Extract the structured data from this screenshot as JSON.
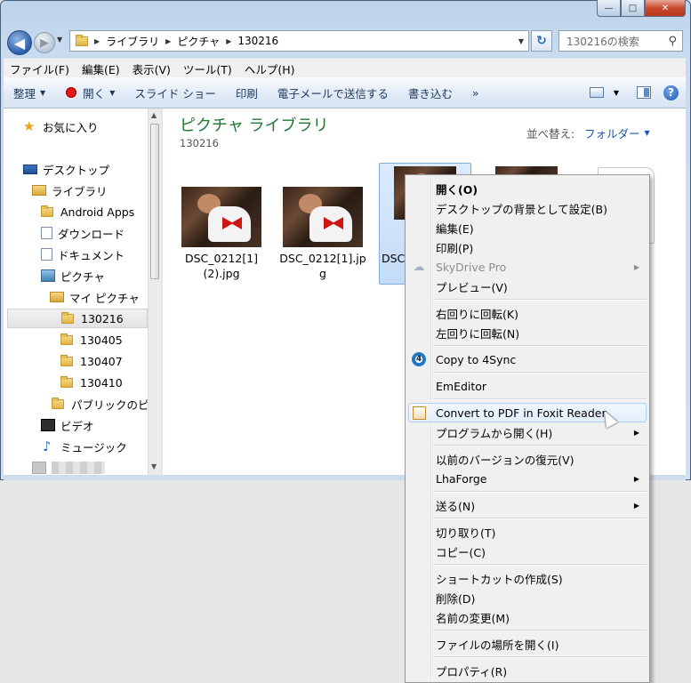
{
  "window": {
    "title_buttons": {
      "minimize": "—",
      "maximize": "□",
      "close": "✕"
    }
  },
  "address": {
    "crumbs": [
      "ライブラリ",
      "ピクチャ",
      "130216"
    ],
    "search_placeholder": "130216の検索"
  },
  "menubar": [
    "ファイル(F)",
    "編集(E)",
    "表示(V)",
    "ツール(T)",
    "ヘルプ(H)"
  ],
  "toolbar": {
    "organize": "整理",
    "open": "開く",
    "slideshow": "スライド ショー",
    "print": "印刷",
    "email": "電子メールで送信する",
    "burn": "書き込む",
    "more": "»"
  },
  "navpane": {
    "items": [
      {
        "label": "お気に入り",
        "icon": "star-icon"
      },
      {
        "label": "デスクトップ",
        "icon": "desktop-icon"
      },
      {
        "label": "ライブラリ",
        "icon": "library-icon"
      },
      {
        "label": "Android Apps",
        "icon": "folder-icon"
      },
      {
        "label": "ダウンロード",
        "icon": "download-folder-icon"
      },
      {
        "label": "ドキュメント",
        "icon": "document-icon"
      },
      {
        "label": "ピクチャ",
        "icon": "pictures-icon"
      },
      {
        "label": "マイ ピクチャ",
        "icon": "folder-icon"
      },
      {
        "label": "130216",
        "icon": "folder-icon"
      },
      {
        "label": "130405",
        "icon": "folder-icon"
      },
      {
        "label": "130407",
        "icon": "folder-icon"
      },
      {
        "label": "130410",
        "icon": "folder-icon"
      },
      {
        "label": "パブリックのピ",
        "icon": "folder-icon"
      },
      {
        "label": "ビデオ",
        "icon": "video-icon"
      },
      {
        "label": "ミュージック",
        "icon": "music-icon"
      }
    ],
    "selected": "130216"
  },
  "content": {
    "library_title": "ピクチャ ライブラリ",
    "library_subtitle": "130216",
    "sort_label": "並べ替え:",
    "sort_value": "フォルダー",
    "files": [
      {
        "name_line1": "DSC_0212[1]",
        "name_line2": "(2).jpg"
      },
      {
        "name_line1": "DSC_0212[1].jp",
        "name_line2": "g"
      },
      {
        "name_line1": "DSC",
        "name_line2": ""
      }
    ]
  },
  "context_menu": {
    "items": [
      {
        "label": "開く(O)",
        "bold": true
      },
      {
        "label": "デスクトップの背景として設定(B)"
      },
      {
        "label": "編集(E)"
      },
      {
        "label": "印刷(P)"
      },
      {
        "label": "SkyDrive Pro",
        "disabled": true,
        "submenu": true,
        "icon": "cloud-icon"
      },
      {
        "label": "プレビュー(V)"
      },
      {
        "label": "右回りに回転(K)"
      },
      {
        "label": "左回りに回転(N)"
      },
      {
        "label": "Copy to 4Sync",
        "icon": "4sync-icon"
      },
      {
        "label": "EmEditor"
      },
      {
        "label": "Convert to PDF in Foxit Reader",
        "highlighted": true,
        "icon": "foxit-icon"
      },
      {
        "label": "プログラムから開く(H)",
        "submenu": true
      },
      {
        "label": "以前のバージョンの復元(V)"
      },
      {
        "label": "LhaForge",
        "submenu": true
      },
      {
        "label": "送る(N)",
        "submenu": true
      },
      {
        "label": "切り取り(T)"
      },
      {
        "label": "コピー(C)"
      },
      {
        "label": "ショートカットの作成(S)"
      },
      {
        "label": "削除(D)"
      },
      {
        "label": "名前の変更(M)"
      },
      {
        "label": "ファイルの場所を開く(I)"
      },
      {
        "label": "プロパティ(R)"
      }
    ]
  }
}
